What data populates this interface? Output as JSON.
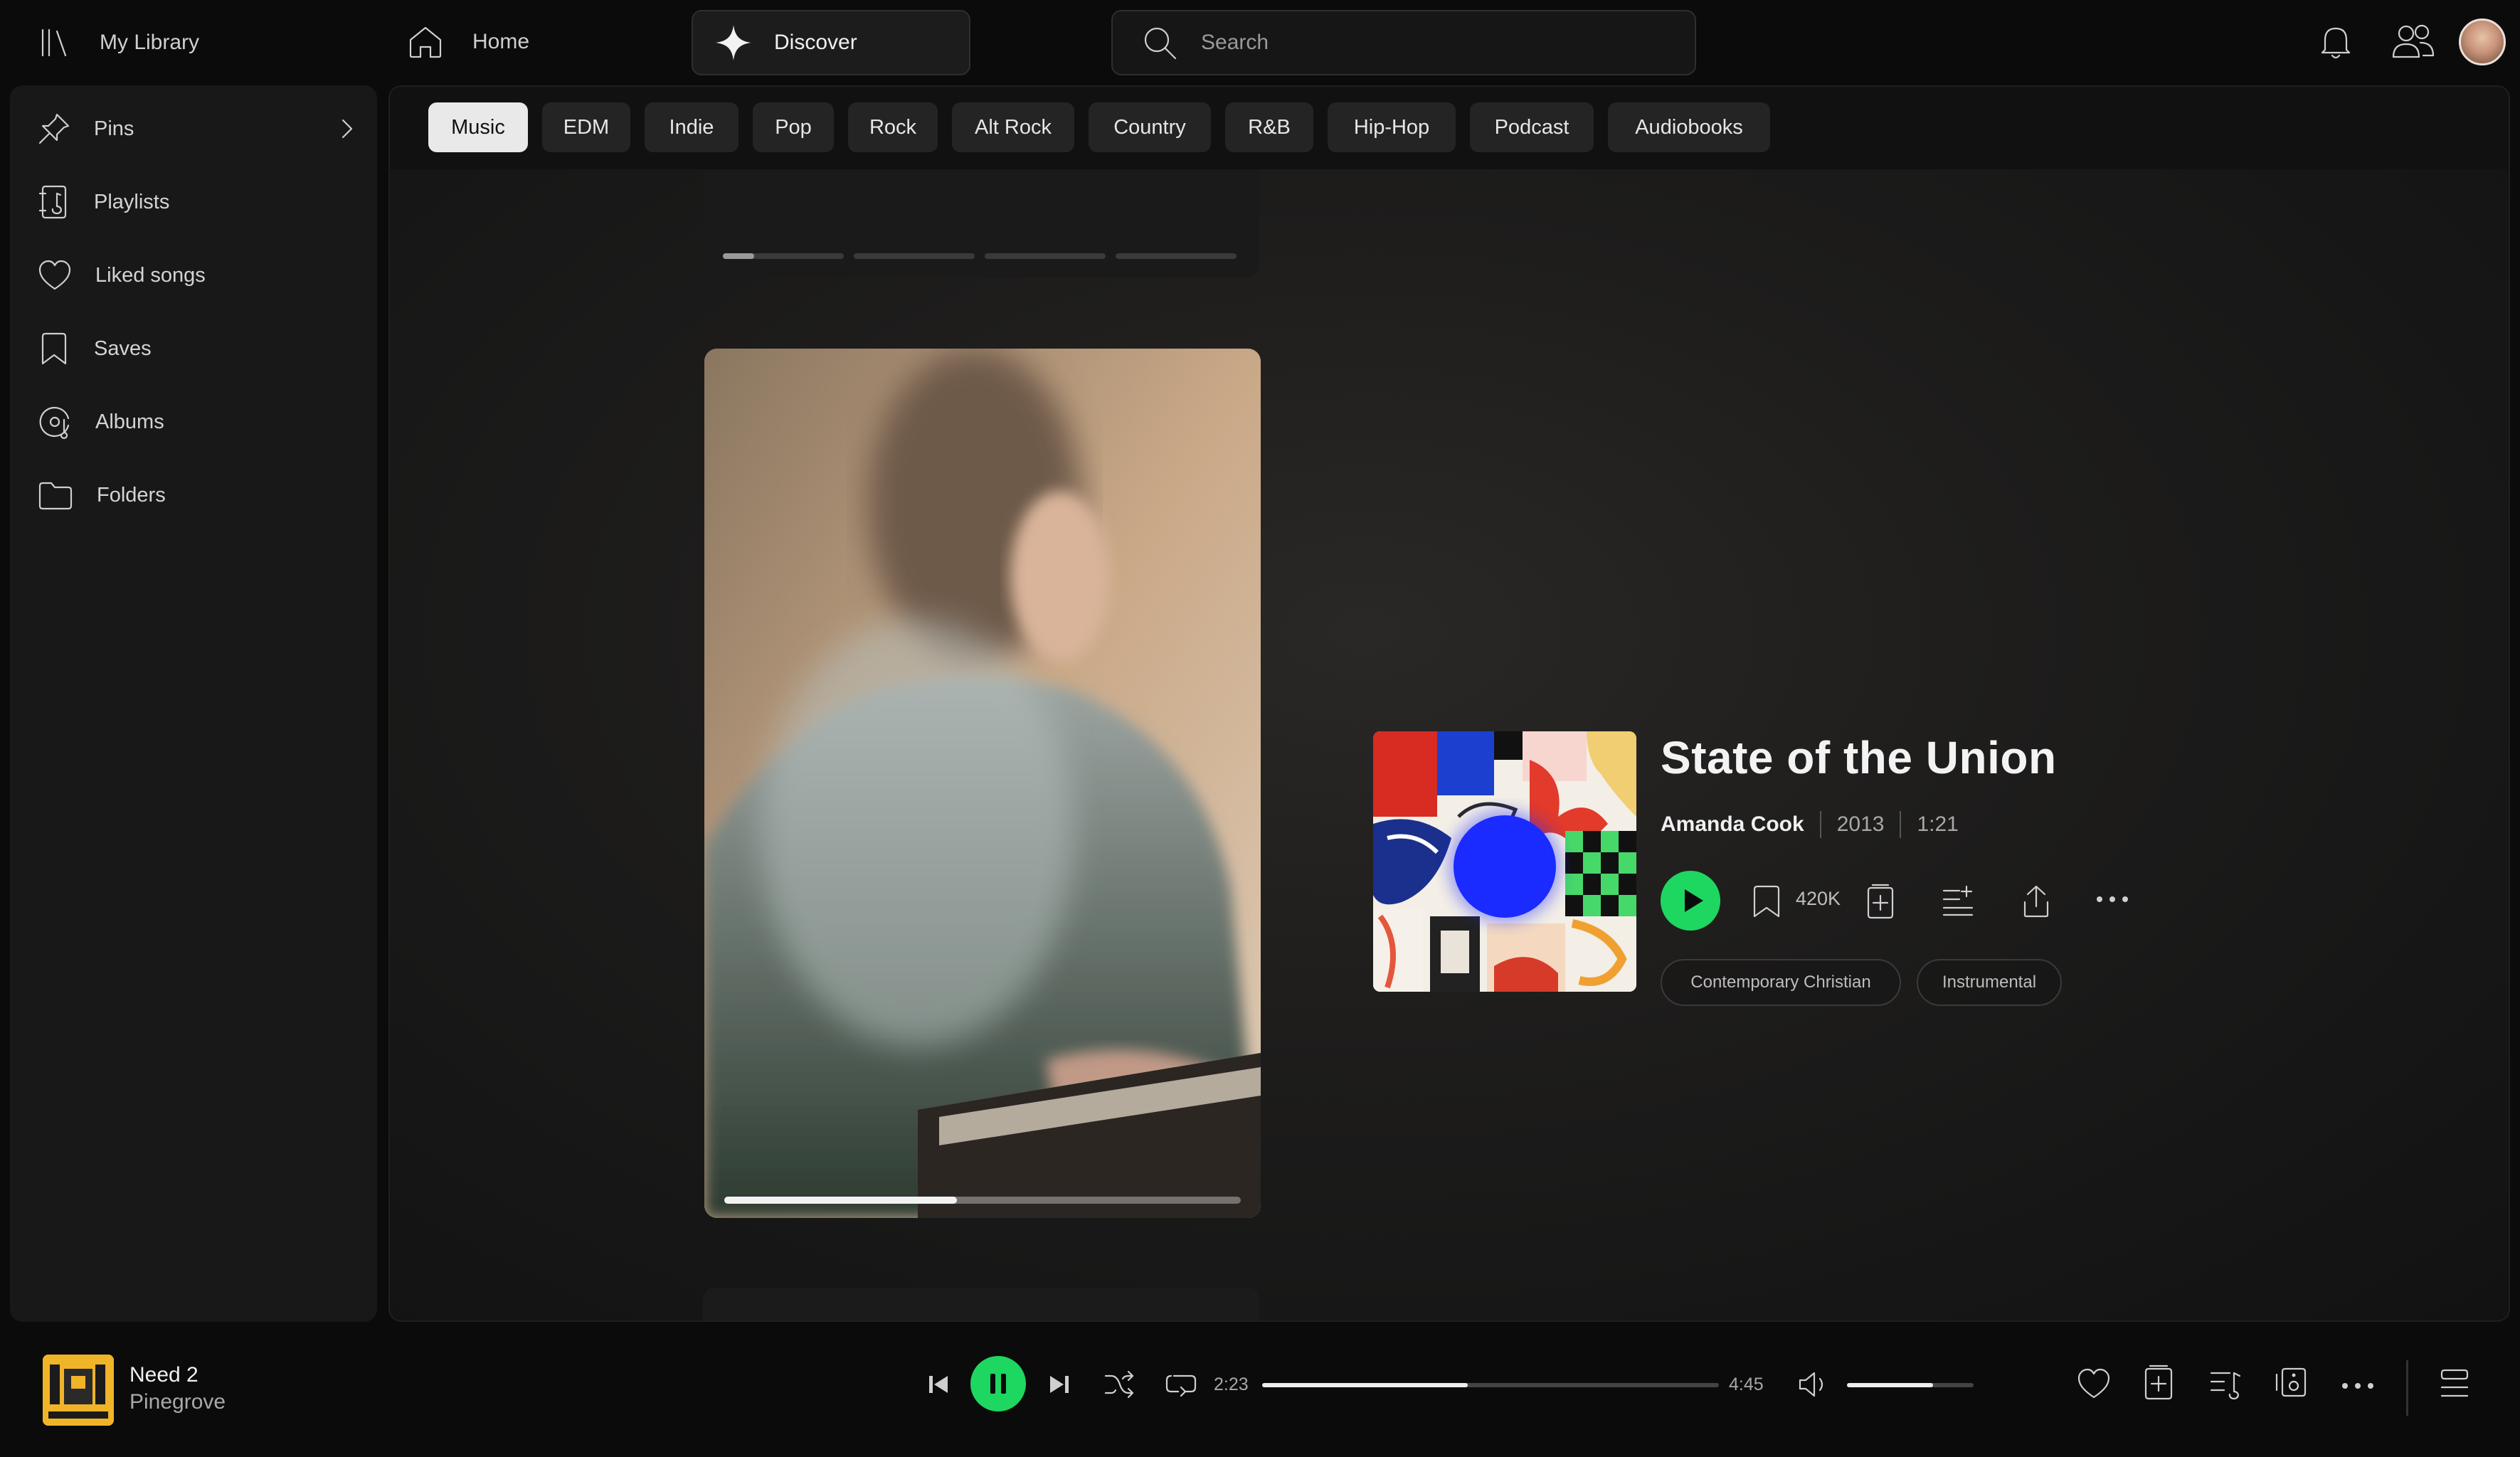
{
  "topbar": {
    "library_label": "My Library",
    "home_label": "Home",
    "discover_label": "Discover",
    "search_placeholder": "Search"
  },
  "sidebar": {
    "items": [
      {
        "label": "Pins",
        "icon": "pin-icon"
      },
      {
        "label": "Playlists",
        "icon": "playlist-icon"
      },
      {
        "label": "Liked songs",
        "icon": "heart-icon"
      },
      {
        "label": "Saves",
        "icon": "bookmark-icon"
      },
      {
        "label": "Albums",
        "icon": "album-icon"
      },
      {
        "label": "Folders",
        "icon": "folder-icon"
      }
    ]
  },
  "chips": [
    "Music",
    "EDM",
    "Indie",
    "Pop",
    "Rock",
    "Alt Rock",
    "Country",
    "R&B",
    "Hip-Hop",
    "Podcast",
    "Audiobooks"
  ],
  "active_chip": "Music",
  "feed": {
    "video_progress_fraction": 0.45,
    "track": {
      "title": "State of the Union",
      "artist": "Amanda Cook",
      "year": "2013",
      "duration": "1:21",
      "save_count": "420K",
      "tags": [
        "Contemporary Christian",
        "Instrumental"
      ]
    }
  },
  "player": {
    "title": "Need 2",
    "artist": "Pinegrove",
    "current_time": "2:23",
    "total_time": "4:45",
    "progress_fraction": 0.45,
    "volume_fraction": 0.68
  },
  "colors": {
    "accent": "#1ed760",
    "background": "#0b0b0b",
    "panel": "#181818"
  }
}
